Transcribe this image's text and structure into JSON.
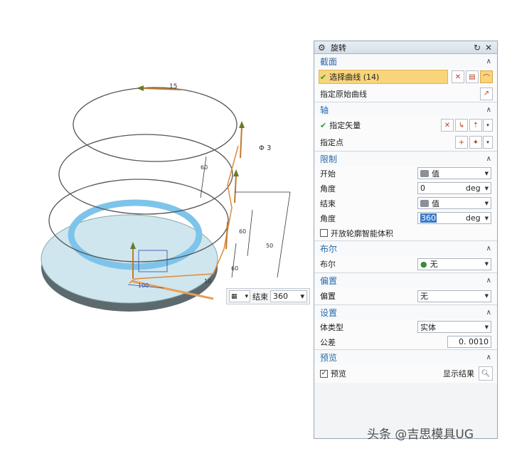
{
  "viewport": {
    "dims": {
      "top_angle": "15",
      "phi": "Φ 3",
      "d1": "60",
      "d2": "60",
      "d3": "60",
      "d4": "50",
      "d5": "100",
      "d6": "10"
    }
  },
  "float_bar": {
    "label": "结束",
    "value": "360"
  },
  "dialog": {
    "title": "旋转",
    "sections": {
      "section": {
        "title": "截面",
        "select_curve": "选择曲线 (14)",
        "origin_curve": "指定原始曲线"
      },
      "axis": {
        "title": "轴",
        "vector": "指定矢量",
        "point": "指定点"
      },
      "limits": {
        "title": "限制",
        "start_label": "开始",
        "start_value": "值",
        "angle1_label": "角度",
        "angle1_value": "0",
        "angle1_unit": "deg",
        "end_label": "结束",
        "end_value": "值",
        "angle2_label": "角度",
        "angle2_value": "360",
        "angle2_unit": "deg",
        "open_profile": "开放轮廓智能体积"
      },
      "boolean": {
        "title": "布尔",
        "label": "布尔",
        "value": "无"
      },
      "offset": {
        "title": "偏置",
        "label": "偏置",
        "value": "无"
      },
      "settings": {
        "title": "设置",
        "body_type_label": "体类型",
        "body_type_value": "实体",
        "tolerance_label": "公差",
        "tolerance_value": "0. 0010"
      },
      "preview": {
        "title": "预览",
        "preview_label": "预览",
        "show_result": "显示结果"
      }
    }
  },
  "watermark": "头条 @吉思模具UG",
  "colors": {
    "accent": "#2a6aa8",
    "highlight": "#f8d47a",
    "selection": "#3a78c7",
    "check": "#2aa02a"
  }
}
